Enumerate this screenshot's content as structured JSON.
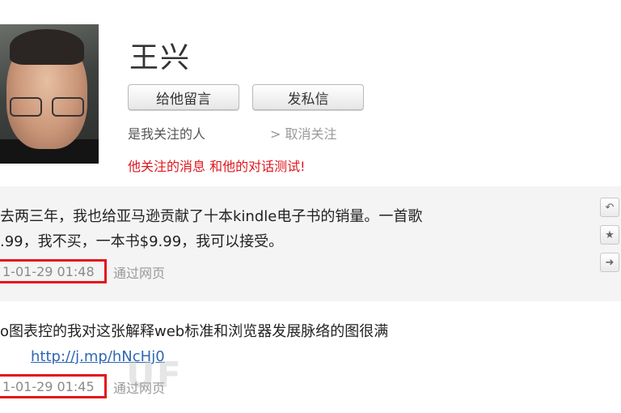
{
  "profile": {
    "name": "王兴",
    "leave_message_label": "给他留言",
    "direct_message_label": "发私信",
    "follow_status": "是我关注的人",
    "unfollow_label": "> 取消关注",
    "note": "他关注的消息 和他的对话测试!"
  },
  "posts": [
    {
      "lines": [
        "去两三年，我也给亚马逊贡献了十本kindle电子书的销量。一首歌",
        ".99，我不买，一本书$9.99，我可以接受。"
      ],
      "timestamp": "1-01-29 01:48",
      "source": "通过网页"
    },
    {
      "lines": [
        "o图表控的我对这张解释web标准和浏览器发展脉络的图很满"
      ],
      "link": "http://j.mp/hNcHj0",
      "timestamp": "1-01-29 01:45",
      "source": "通过网页"
    }
  ],
  "side_actions": [
    "reply-icon",
    "star-icon",
    "forward-icon"
  ],
  "watermark": "UF"
}
